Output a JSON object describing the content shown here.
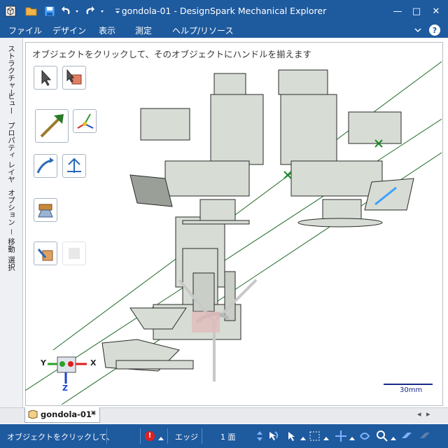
{
  "window": {
    "title": "gondola-01 - DesignSpark Mechanical Explorer"
  },
  "controls": {
    "minimize": "—",
    "maximize": "□",
    "close": "✕"
  },
  "menu": {
    "file": "ファイル",
    "design": "デザイン",
    "view": "表示",
    "measure": "測定",
    "help": "ヘルプ/リソース"
  },
  "help_icon_text": "?",
  "side_tabs": [
    "ストラクチャー",
    "ビュー",
    "プロパティ",
    "レイヤ",
    "オプション － 移動",
    "選択"
  ],
  "canvas": {
    "hint": "オブジェクトをクリックして、そのオブジェクトにハンドルを揃えます"
  },
  "triad": {
    "x": "X",
    "y": "Y",
    "z": "Z"
  },
  "scale_bar": {
    "label": "30mm"
  },
  "doc_tab": {
    "label": "gondola-01*",
    "close": "✕"
  },
  "tab_nav": {
    "prev": "◂",
    "next": "▸"
  },
  "status": {
    "message": "オブジェクトをクリックして、",
    "alert": "!",
    "selection_mode": "エッジ",
    "selection_count": "1 面"
  },
  "colors": {
    "accent": "#1e5a9e",
    "model": "#d7dcd4",
    "axis_x": "#e01d1d",
    "axis_y": "#2aa02a",
    "axis_z": "#1a40d0"
  }
}
